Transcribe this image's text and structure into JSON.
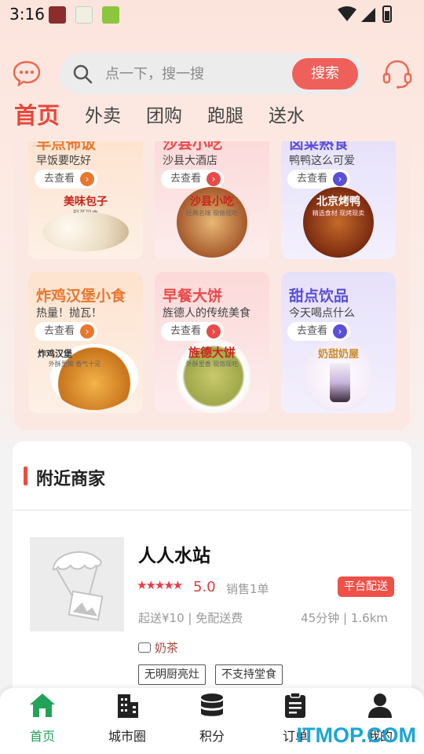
{
  "status_bar": {
    "time": "3:16",
    "apps": [
      "#8b2d2d",
      "#f5f5e6",
      "#8cc63f"
    ]
  },
  "header": {
    "search_placeholder": "点一下，搜一搜",
    "search_button": "搜索",
    "accent": "#f0605a"
  },
  "tabs": [
    {
      "label": "首页",
      "active": true
    },
    {
      "label": "外卖",
      "active": false
    },
    {
      "label": "团购",
      "active": false
    },
    {
      "label": "跑腿",
      "active": false
    },
    {
      "label": "送水",
      "active": false
    }
  ],
  "categories": [
    {
      "title": "早点佈饭",
      "subtitle": "早饭要吃好",
      "go": "去查看",
      "food": "美味包子",
      "tag": "现蒸现卖",
      "title_color": "#e8772e",
      "bg": "#fde7d6",
      "arrow_color": "#e8772e"
    },
    {
      "title": "沙县小吃",
      "subtitle": "沙县大酒店",
      "go": "去查看",
      "food": "沙县小吃",
      "tag": "经典名味 现做现吃",
      "title_color": "#e84a4a",
      "bg": "#fde0e0",
      "arrow_color": "#e84a4a"
    },
    {
      "title": "卤菜熟食",
      "subtitle": "鸭鸭这么可爱",
      "go": "去查看",
      "food": "北京烤鸭",
      "tag": "精选食材 现烤现卖",
      "title_color": "#5b4ed8",
      "bg": "#ece8fb",
      "arrow_color": "#5b4ed8"
    },
    {
      "title": "炸鸡汉堡小食",
      "subtitle": "热量！抛瓦！",
      "go": "去查看",
      "food": "炸鸡汉堡",
      "tag": "外酥里嫩 香气十足",
      "title_color": "#e8772e",
      "bg": "#fde7d6",
      "arrow_color": "#e8772e"
    },
    {
      "title": "早餐大饼",
      "subtitle": "旌德人的传统美食",
      "go": "去查看",
      "food": "旌德大饼",
      "tag": "外酥里香 现烙现吃",
      "title_color": "#e84a4a",
      "bg": "#fde0e0",
      "arrow_color": "#e84a4a"
    },
    {
      "title": "甜点饮品",
      "subtitle": "今天喝点什么",
      "go": "去查看",
      "food": "奶甜奶屋",
      "tag": "",
      "title_color": "#5b4ed8",
      "bg": "#ece8fb",
      "arrow_color": "#5b4ed8"
    }
  ],
  "nearby": {
    "title": "附近商家",
    "shop": {
      "name": "人人水站",
      "stars": "★★★★★",
      "rating": "5.0",
      "sales": "销售1单",
      "delivery_tag": "平台配送",
      "min_order": "起送¥10 | 免配送费",
      "distance": "45分钟 | 1.6km",
      "category": "奶茶",
      "badges": [
        "无明厨亮灶",
        "不支持堂食"
      ]
    }
  },
  "bottom_nav": [
    {
      "label": "首页",
      "icon": "home-icon",
      "active": true
    },
    {
      "label": "城市圈",
      "icon": "buildings-icon",
      "active": false
    },
    {
      "label": "积分",
      "icon": "coins-icon",
      "active": false
    },
    {
      "label": "订单",
      "icon": "clipboard-icon",
      "active": false
    },
    {
      "label": "我的",
      "icon": "user-icon",
      "active": false
    }
  ],
  "watermark": "ITMOP.COM"
}
